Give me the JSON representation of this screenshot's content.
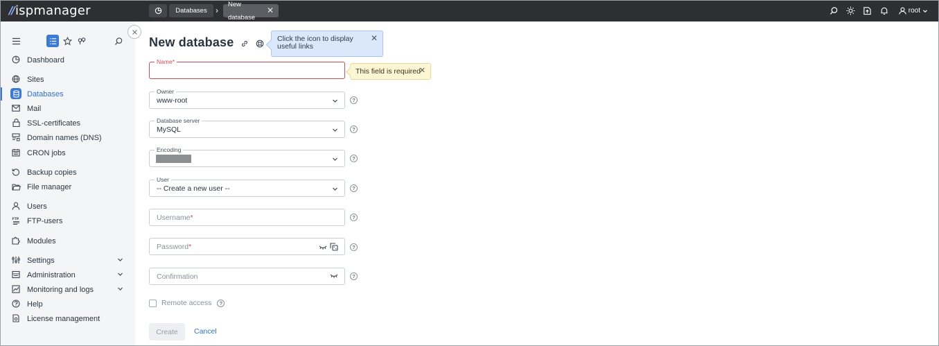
{
  "app": {
    "logo_mark": "//",
    "logo_text": "ispmanager"
  },
  "breadcrumbs": {
    "items": [
      "Databases",
      "New database"
    ],
    "separator": "›"
  },
  "topbar": {
    "user": "root"
  },
  "sidebar": {
    "items": [
      {
        "label": "Dashboard",
        "icon": "dashboard-icon"
      },
      {
        "label": "Sites",
        "icon": "globe-icon"
      },
      {
        "label": "Databases",
        "icon": "database-icon",
        "active": true
      },
      {
        "label": "Mail",
        "icon": "mail-icon"
      },
      {
        "label": "SSL-certificates",
        "icon": "lock-icon"
      },
      {
        "label": "Domain names (DNS)",
        "icon": "dns-icon"
      },
      {
        "label": "CRON jobs",
        "icon": "calendar-icon"
      },
      {
        "label": "Backup copies",
        "icon": "backup-icon"
      },
      {
        "label": "File manager",
        "icon": "folder-icon"
      },
      {
        "label": "Users",
        "icon": "user-icon"
      },
      {
        "label": "FTP-users",
        "icon": "ftp-icon"
      },
      {
        "label": "Modules",
        "icon": "puzzle-icon"
      },
      {
        "label": "Settings",
        "icon": "sliders-icon",
        "expandable": true
      },
      {
        "label": "Administration",
        "icon": "server-icon",
        "expandable": true
      },
      {
        "label": "Monitoring and logs",
        "icon": "chart-icon",
        "expandable": true
      },
      {
        "label": "Help",
        "icon": "help-icon"
      },
      {
        "label": "License management",
        "icon": "license-icon"
      }
    ]
  },
  "page": {
    "title": "New database",
    "info_tooltip": "Click the icon to display useful links",
    "error_tooltip": "This field is required"
  },
  "form": {
    "name_label": "Name",
    "owner_label": "Owner",
    "owner_value": "www-root",
    "server_label": "Database server",
    "server_value": "MySQL",
    "encoding_label": "Encoding",
    "user_label": "User",
    "user_value": "-- Create a new user --",
    "username_placeholder": "Username",
    "password_placeholder": "Password",
    "confirmation_placeholder": "Confirmation",
    "remote_access_label": "Remote access",
    "required_mark": "*",
    "help_mark": "?"
  },
  "buttons": {
    "create": "Create",
    "cancel": "Cancel"
  },
  "colors": {
    "accent": "#3a7bd5",
    "error": "#d24a54",
    "topbar": "#2d2f33",
    "sidebar": "#f4f5f7"
  }
}
